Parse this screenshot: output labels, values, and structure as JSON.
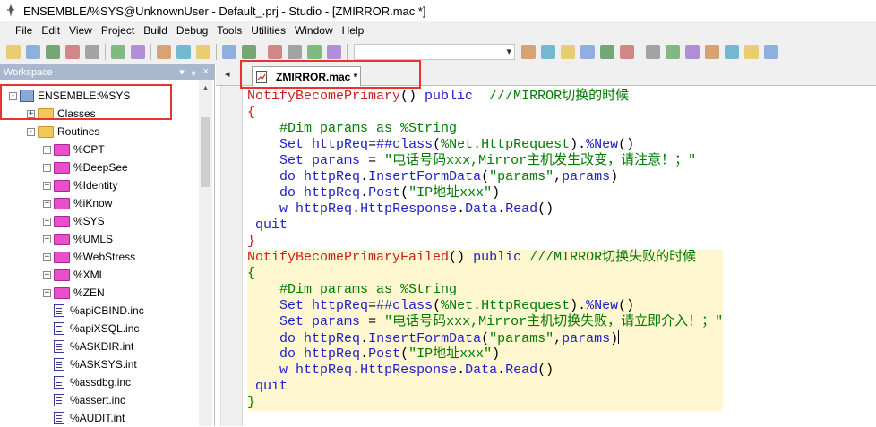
{
  "window": {
    "title": "ENSEMBLE/%SYS@UnknownUser - Default_.prj - Studio - [ZMIRROR.mac *]"
  },
  "menu": [
    "File",
    "Edit",
    "View",
    "Project",
    "Build",
    "Debug",
    "Tools",
    "Utilities",
    "Window",
    "Help"
  ],
  "toolbar_icons": [
    "new-file-icon",
    "open-folder-icon",
    "save-icon",
    "save-all-icon",
    "print-icon",
    "back-icon",
    "forward-icon",
    "cut-icon",
    "copy-icon",
    "paste-icon",
    "undo-icon",
    "redo-icon",
    "view-code-icon",
    "view-doc-icon",
    "check-icon",
    "list-icon",
    "class-wizard-icon",
    "inspector-icon",
    "route-icon",
    "globe-icon",
    "compile-icon",
    "stop-icon",
    "window-icon",
    "window-icon-2",
    "comment-icon",
    "comment-icon-2",
    "pause-icon",
    "run-icon",
    "step-icon"
  ],
  "workspace": {
    "title": "Workspace",
    "controls": [
      "▾",
      "ᵩ",
      "×"
    ],
    "tree": [
      {
        "label": "ENSEMBLE:%SYS",
        "kind": "server",
        "exp": "-",
        "level": 0
      },
      {
        "label": "Classes",
        "kind": "folder",
        "exp": "+",
        "level": 1
      },
      {
        "label": "Routines",
        "kind": "folder",
        "exp": "-",
        "level": 1
      },
      {
        "label": "%CPT",
        "kind": "pfolder",
        "exp": "+",
        "level": 2
      },
      {
        "label": "%DeepSee",
        "kind": "pfolder",
        "exp": "+",
        "level": 2
      },
      {
        "label": "%Identity",
        "kind": "pfolder",
        "exp": "+",
        "level": 2
      },
      {
        "label": "%iKnow",
        "kind": "pfolder",
        "exp": "+",
        "level": 2
      },
      {
        "label": "%SYS",
        "kind": "pfolder",
        "exp": "+",
        "level": 2
      },
      {
        "label": "%UMLS",
        "kind": "pfolder",
        "exp": "+",
        "level": 2
      },
      {
        "label": "%WebStress",
        "kind": "pfolder",
        "exp": "+",
        "level": 2
      },
      {
        "label": "%XML",
        "kind": "pfolder",
        "exp": "+",
        "level": 2
      },
      {
        "label": "%ZEN",
        "kind": "pfolder",
        "exp": "+",
        "level": 2
      },
      {
        "label": "%apiCBIND.inc",
        "kind": "doc",
        "exp": "",
        "level": 2
      },
      {
        "label": "%apiXSQL.inc",
        "kind": "doc",
        "exp": "",
        "level": 2
      },
      {
        "label": "%ASKDIR.int",
        "kind": "doc",
        "exp": "",
        "level": 2
      },
      {
        "label": "%ASKSYS.int",
        "kind": "doc",
        "exp": "",
        "level": 2
      },
      {
        "label": "%assdbg.inc",
        "kind": "doc",
        "exp": "",
        "level": 2
      },
      {
        "label": "%assert.inc",
        "kind": "doc",
        "exp": "",
        "level": 2
      },
      {
        "label": "%AUDIT.int",
        "kind": "doc",
        "exp": "",
        "level": 2
      }
    ]
  },
  "tabs": {
    "nav": "◂",
    "active": "ZMIRROR.mac *"
  },
  "code": [
    [
      [
        "m",
        "NotifyBecomePrimary"
      ],
      [
        "p",
        "() "
      ],
      [
        "k",
        "public"
      ],
      [
        "p",
        "  "
      ],
      [
        "s",
        "///MIRROR切换的时候"
      ]
    ],
    [
      [
        "br",
        "{"
      ]
    ],
    [
      [
        "p",
        "    "
      ],
      [
        "s",
        "#Dim params as %String"
      ]
    ],
    [
      [
        "p",
        "    "
      ],
      [
        "k",
        "Set"
      ],
      [
        "p",
        " "
      ],
      [
        "k",
        "httpReq"
      ],
      [
        "p",
        "="
      ],
      [
        "k",
        "##class"
      ],
      [
        "p",
        "("
      ],
      [
        "s",
        "%Net.HttpRequest"
      ],
      [
        "p",
        ")."
      ],
      [
        "k",
        "%New"
      ],
      [
        "p",
        "()"
      ]
    ],
    [
      [
        "p",
        "    "
      ],
      [
        "k",
        "Set"
      ],
      [
        "p",
        " "
      ],
      [
        "k",
        "params"
      ],
      [
        "p",
        " = "
      ],
      [
        "s",
        "\"电话号码xxx,Mirror主机发生改变，请注意！；\""
      ]
    ],
    [
      [
        "p",
        "    "
      ],
      [
        "k",
        "do"
      ],
      [
        "p",
        " "
      ],
      [
        "k",
        "httpReq"
      ],
      [
        "p",
        "."
      ],
      [
        "k",
        "InsertFormData"
      ],
      [
        "p",
        "("
      ],
      [
        "s",
        "\"params\""
      ],
      [
        "p",
        ","
      ],
      [
        "k",
        "params"
      ],
      [
        "p",
        ")"
      ]
    ],
    [
      [
        "p",
        "    "
      ],
      [
        "k",
        "do"
      ],
      [
        "p",
        " "
      ],
      [
        "k",
        "httpReq"
      ],
      [
        "p",
        "."
      ],
      [
        "k",
        "Post"
      ],
      [
        "p",
        "("
      ],
      [
        "s",
        "\"IP地址xxx\""
      ],
      [
        "p",
        ")"
      ]
    ],
    [
      [
        "p",
        "    "
      ],
      [
        "k",
        "w"
      ],
      [
        "p",
        " "
      ],
      [
        "k",
        "httpReq"
      ],
      [
        "p",
        "."
      ],
      [
        "k",
        "HttpResponse"
      ],
      [
        "p",
        "."
      ],
      [
        "k",
        "Data"
      ],
      [
        "p",
        "."
      ],
      [
        "k",
        "Read"
      ],
      [
        "p",
        "()"
      ]
    ],
    [
      [
        "p",
        " "
      ],
      [
        "k",
        "quit"
      ]
    ],
    [
      [
        "br",
        "}"
      ]
    ],
    [
      [
        "m",
        "NotifyBecomePrimaryFailed"
      ],
      [
        "p",
        "() "
      ],
      [
        "k",
        "public"
      ],
      [
        "p",
        " "
      ],
      [
        "s",
        "///MIRROR切换失败的时候"
      ]
    ],
    [
      [
        "s",
        "{"
      ]
    ],
    [
      [
        "p",
        "    "
      ],
      [
        "s",
        "#Dim params as %String"
      ]
    ],
    [
      [
        "p",
        "    "
      ],
      [
        "k",
        "Set"
      ],
      [
        "p",
        " "
      ],
      [
        "k",
        "httpReq"
      ],
      [
        "p",
        "="
      ],
      [
        "k",
        "##class"
      ],
      [
        "p",
        "("
      ],
      [
        "s",
        "%Net.HttpRequest"
      ],
      [
        "p",
        ")."
      ],
      [
        "k",
        "%New"
      ],
      [
        "p",
        "()"
      ]
    ],
    [
      [
        "p",
        "    "
      ],
      [
        "k",
        "Set"
      ],
      [
        "p",
        " "
      ],
      [
        "k",
        "params"
      ],
      [
        "p",
        " = "
      ],
      [
        "s",
        "\"电话号码xxx,Mirror主机切换失败，请立即介入！；\""
      ]
    ],
    [
      [
        "p",
        "    "
      ],
      [
        "k",
        "do"
      ],
      [
        "p",
        " "
      ],
      [
        "k",
        "httpReq"
      ],
      [
        "p",
        "."
      ],
      [
        "k",
        "InsertFormData"
      ],
      [
        "p",
        "("
      ],
      [
        "s",
        "\"params\""
      ],
      [
        "p",
        ","
      ],
      [
        "k",
        "params"
      ],
      [
        "p",
        ")"
      ],
      [
        "cursor",
        ""
      ]
    ],
    [
      [
        "p",
        "    "
      ],
      [
        "k",
        "do"
      ],
      [
        "p",
        " "
      ],
      [
        "k",
        "httpReq"
      ],
      [
        "p",
        "."
      ],
      [
        "k",
        "Post"
      ],
      [
        "p",
        "("
      ],
      [
        "s",
        "\"IP地址xxx\""
      ],
      [
        "p",
        ")"
      ]
    ],
    [
      [
        "p",
        "    "
      ],
      [
        "k",
        "w"
      ],
      [
        "p",
        " "
      ],
      [
        "k",
        "httpReq"
      ],
      [
        "p",
        "."
      ],
      [
        "k",
        "HttpResponse"
      ],
      [
        "p",
        "."
      ],
      [
        "k",
        "Data"
      ],
      [
        "p",
        "."
      ],
      [
        "k",
        "Read"
      ],
      [
        "p",
        "()"
      ]
    ],
    [
      [
        "p",
        " "
      ],
      [
        "k",
        "quit"
      ]
    ],
    [
      [
        "s",
        "}"
      ]
    ]
  ],
  "colors": {
    "macro_label": "#c81e1e",
    "keyword": "#1e1ec8",
    "string_comment": "#007a00",
    "annotation_box": "#e8332e"
  }
}
